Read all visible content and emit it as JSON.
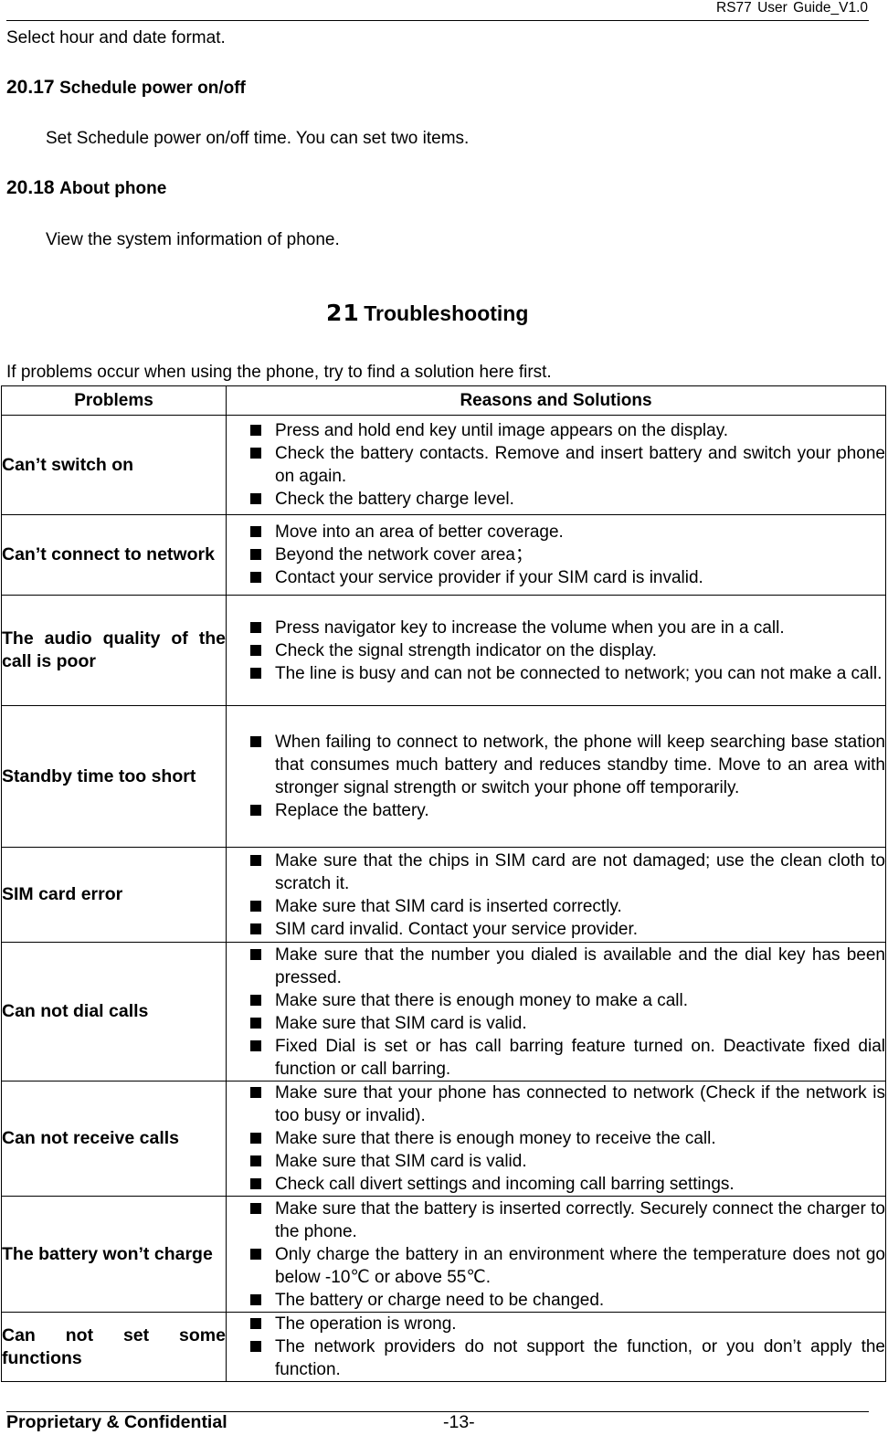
{
  "header": {
    "doc_title": "RS77  User  Guide_V1.0"
  },
  "intro_line": "Select hour and date format.",
  "sections": [
    {
      "number": "20.17",
      "title": "Schedule power on/off",
      "body": "Set Schedule power on/off time. You can set two items."
    },
    {
      "number": "20.18",
      "title": "About phone",
      "body": "View the system information of phone."
    }
  ],
  "chapter": {
    "number": "21",
    "title": "Troubleshooting"
  },
  "chapter_intro": "If problems occur when using the phone, try to find a solution here first.",
  "table": {
    "headers": [
      "Problems",
      "Reasons and Solutions"
    ],
    "rows": [
      {
        "problem": "Can’t switch on",
        "solutions": [
          "Press and hold end key until image appears on the display.",
          "Check the battery contacts. Remove and insert battery and switch your phone on again.",
          "Check the battery charge level."
        ]
      },
      {
        "problem": "Can’t connect to network",
        "solutions": [
          "Move into an area of better coverage.",
          "Beyond the network cover area；",
          "Contact your service provider if your SIM card is invalid."
        ]
      },
      {
        "problem": "The audio quality of the call is poor",
        "solutions": [
          "Press navigator key to increase the volume when you are in a call.",
          "Check the signal strength indicator on the display.",
          "The line is busy and can not be connected to network; you can not make a call."
        ]
      },
      {
        "problem": "Standby time too short",
        "solutions": [
          "When failing to connect to network, the phone will keep searching base station that consumes much battery and reduces standby time. Move to an area with stronger signal strength or switch your phone off temporarily.",
          "Replace the battery."
        ]
      },
      {
        "problem": "SIM card error",
        "solutions": [
          "Make sure that the chips in SIM card are not damaged; use the clean cloth to scratch it.",
          "Make sure that SIM card is inserted correctly.",
          "SIM card invalid. Contact your service provider."
        ]
      },
      {
        "problem": "Can not dial calls",
        "solutions": [
          "Make sure that the number you dialed is available and the dial key has been pressed.",
          "Make sure that there is enough money to make a call.",
          "Make sure that SIM card is valid.",
          "Fixed Dial is set or has call barring feature turned on. Deactivate fixed dial function or call barring."
        ]
      },
      {
        "problem": "Can not receive calls",
        "solutions": [
          "Make sure that your phone has connected to network (Check if the network is too busy or invalid).",
          "Make sure that there is enough money to receive the call.",
          "Make sure that SIM card is valid.",
          "Check call divert settings and incoming call barring settings."
        ]
      },
      {
        "problem": "The battery won’t charge",
        "solutions": [
          "Make sure that the battery is inserted correctly. Securely connect the charger to the phone.",
          "Only charge the battery in an environment where the temperature does not go below -10℃ or above 55℃.",
          "The battery or charge need to be changed."
        ]
      },
      {
        "problem": "Can not set some functions",
        "solutions": [
          "The operation is wrong.",
          "The network providers do not support the function, or you don’t apply the function."
        ]
      }
    ]
  },
  "bullet_icon": "black-square-bullet",
  "footer": {
    "left": "Proprietary & Confidential",
    "page": "-13-"
  }
}
